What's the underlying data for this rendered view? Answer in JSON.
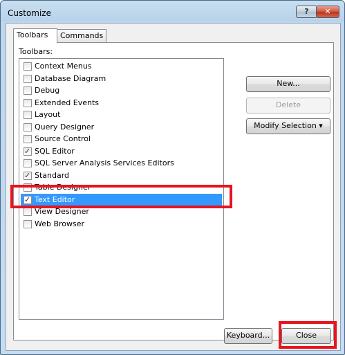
{
  "window": {
    "title": "Customize",
    "help_glyph": "?",
    "close_glyph": "✕"
  },
  "tabs": [
    {
      "label": "Toolbars",
      "active": true
    },
    {
      "label": "Commands",
      "active": false
    }
  ],
  "panel": {
    "label": "Toolbars:"
  },
  "toolbars": [
    {
      "label": "Context Menus",
      "checked": false
    },
    {
      "label": "Database Diagram",
      "checked": false
    },
    {
      "label": "Debug",
      "checked": false
    },
    {
      "label": "Extended Events",
      "checked": false
    },
    {
      "label": "Layout",
      "checked": false
    },
    {
      "label": "Query Designer",
      "checked": false
    },
    {
      "label": "Source Control",
      "checked": false
    },
    {
      "label": "SQL Editor",
      "checked": true
    },
    {
      "label": "SQL Server Analysis Services Editors",
      "checked": false
    },
    {
      "label": "Standard",
      "checked": true
    },
    {
      "label": "Table Designer",
      "checked": false
    },
    {
      "label": "Text Editor",
      "checked": true,
      "selected": true
    },
    {
      "label": "View Designer",
      "checked": false
    },
    {
      "label": "Web Browser",
      "checked": false
    }
  ],
  "buttons": {
    "new": "New...",
    "delete": "Delete",
    "modify": "Modify Selection ▾",
    "keyboard": "Keyboard...",
    "close": "Close"
  },
  "colors": {
    "selection": "#3399ff",
    "highlight": "#e8141e"
  }
}
